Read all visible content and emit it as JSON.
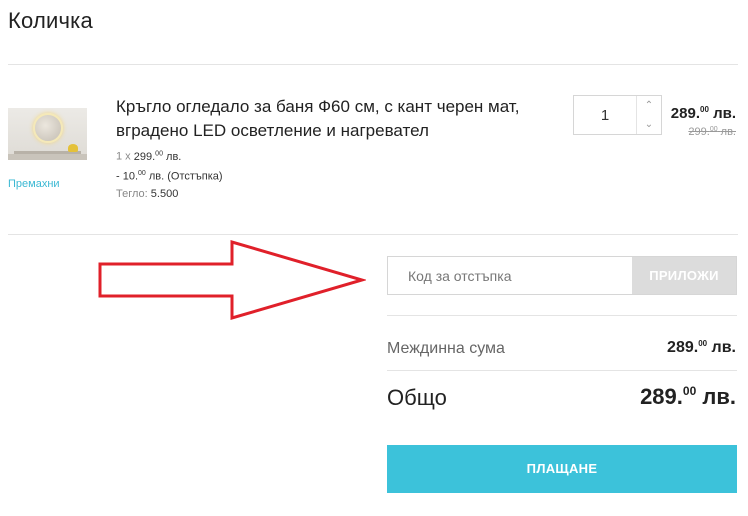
{
  "page": {
    "title": "Количка"
  },
  "item": {
    "name": "Кръгло огледало за баня Ф60 см, с кант черен мат, вградено LED осветление и нагревател",
    "remove_label": "Премахни",
    "unit_line": {
      "qty_prefix": "1 x",
      "price_int": "299.",
      "price_dec": "00",
      "currency": "лв."
    },
    "discount_line": {
      "prefix": "- 10.",
      "dec": "00",
      "suffix": "лв. (Отстъпка)"
    },
    "weight_line": {
      "label": "Тегло:",
      "value": "5.500"
    },
    "quantity": "1",
    "qty_up_icon": "chevron-up-icon",
    "qty_down_icon": "chevron-down-icon",
    "price_now": {
      "int": "289.",
      "dec": "00",
      "currency": "лв."
    },
    "price_old": {
      "int": "299.",
      "dec": "00",
      "currency": "лв."
    },
    "image_icon": "round-led-mirror-thumbnail"
  },
  "annotation": {
    "icon": "red-arrow-right-icon",
    "color": "#e0202a"
  },
  "coupon": {
    "placeholder": "Код за отстъпка",
    "button_label": "ПРИЛОЖИ"
  },
  "summary": {
    "subtotal_label": "Междинна сума",
    "subtotal": {
      "int": "289.",
      "dec": "00",
      "currency": "лв."
    },
    "total_label": "Общо",
    "total": {
      "int": "289.",
      "dec": "00",
      "currency": "лв."
    }
  },
  "checkout": {
    "button_label": "ПЛАЩАНЕ"
  },
  "colors": {
    "accent": "#3cc2da",
    "link": "#3bb8d3",
    "disabled_button": "#dcdcdc"
  }
}
